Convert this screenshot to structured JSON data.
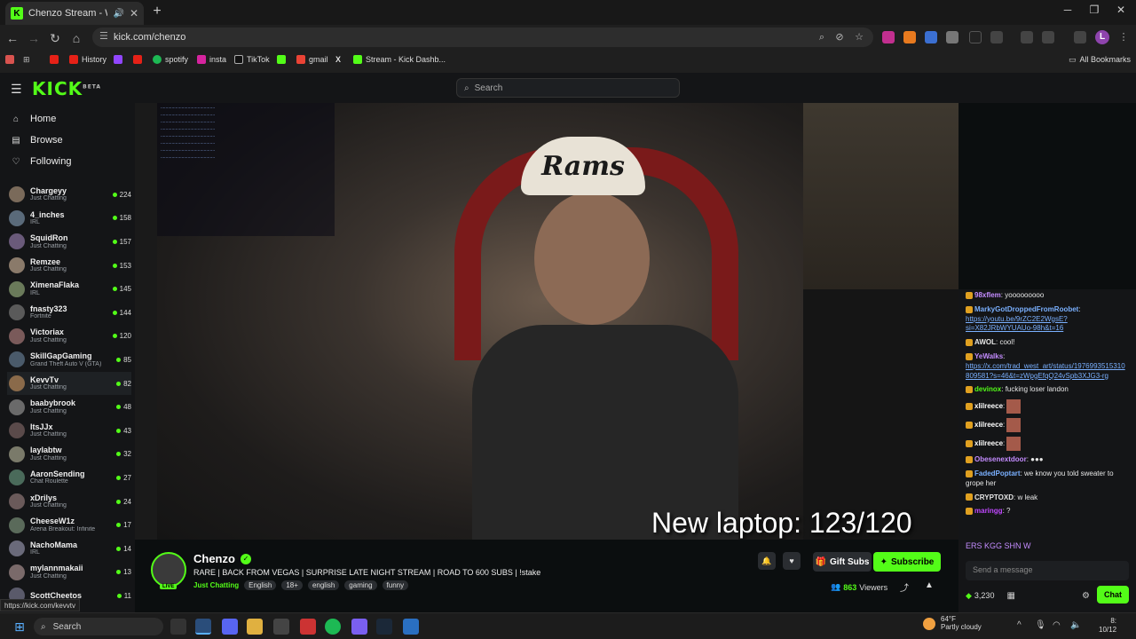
{
  "browser": {
    "tab_title": "Chenzo Stream - Watch Live",
    "url": "kick.com/chenzo",
    "bookmarks": [
      "History",
      "spotify",
      "insta",
      "TikTok",
      "gmail",
      "Stream - Kick Dashb..."
    ],
    "all_bookmarks": "All Bookmarks",
    "profile_initial": "L",
    "status_url": "https://kick.com/kevvtv"
  },
  "header": {
    "logo": "KICK",
    "logo_badge": "BETA",
    "search_placeholder": "Search"
  },
  "sidebar": {
    "nav": [
      {
        "label": "Home",
        "icon": "home-icon"
      },
      {
        "label": "Browse",
        "icon": "browse-icon"
      },
      {
        "label": "Following",
        "icon": "heart-icon"
      }
    ],
    "followed": [
      {
        "name": "Chargeyy",
        "category": "Just Chatting",
        "viewers": "224"
      },
      {
        "name": "4_inches",
        "category": "IRL",
        "viewers": "158"
      },
      {
        "name": "SquidRon",
        "category": "Just Chatting",
        "viewers": "157"
      },
      {
        "name": "Remzee",
        "category": "Just Chatting",
        "viewers": "153"
      },
      {
        "name": "XimenaFlaka",
        "category": "IRL",
        "viewers": "145"
      },
      {
        "name": "fnasty323",
        "category": "Fortnite",
        "viewers": "144"
      },
      {
        "name": "Victoriax",
        "category": "Just Chatting",
        "viewers": "120"
      },
      {
        "name": "SkillGapGaming",
        "category": "Grand Theft Auto V (GTA)",
        "viewers": "85"
      },
      {
        "name": "KevvTv",
        "category": "Just Chatting",
        "viewers": "82"
      },
      {
        "name": "baabybrook",
        "category": "Just Chatting",
        "viewers": "48"
      },
      {
        "name": "ItsJJx",
        "category": "Just Chatting",
        "viewers": "43"
      },
      {
        "name": "laylabtw",
        "category": "Just Chatting",
        "viewers": "32"
      },
      {
        "name": "AaronSending",
        "category": "Chat Roulette",
        "viewers": "27"
      },
      {
        "name": "xDrilys",
        "category": "Just Chatting",
        "viewers": "24"
      },
      {
        "name": "CheeseW1z",
        "category": "Arena Breakout: Infinite",
        "viewers": "17"
      },
      {
        "name": "NachoMama",
        "category": "IRL",
        "viewers": "14"
      },
      {
        "name": "mylannmakaii",
        "category": "Just Chatting",
        "viewers": "13"
      },
      {
        "name": "ScottCheetos",
        "category": "",
        "viewers": "11"
      }
    ]
  },
  "video": {
    "overlay_text": "New laptop: 123/120",
    "cap_text": "Rams"
  },
  "stream": {
    "streamer": "Chenzo",
    "live_label": "LIVE",
    "title": "RARE | BACK FROM VEGAS | SURPRISE LATE NIGHT STREAM | ROAD TO 600 SUBS | !stake",
    "category": "Just Chatting",
    "tags": [
      "English",
      "18+",
      "english",
      "gaming",
      "funny"
    ],
    "gift_label": "Gift Subs",
    "subscribe_label": "Subscribe",
    "viewers_count": "863",
    "viewers_label": "Viewers"
  },
  "chat": {
    "messages": [
      {
        "user": "98xflem",
        "text": "yooooooooo",
        "color": "#c48cff"
      },
      {
        "user": "MarkyGotDroppedFromRoobet",
        "text": "https://youtu.be/9rZC2E2WgsE?si=X82JRbWYUAUo-98h&t=16",
        "color": "#7ab0ff",
        "link": true
      },
      {
        "user": "AWOL",
        "text": "cool!",
        "color": "#e6e6e6"
      },
      {
        "user": "YeWalks",
        "text": "https://x.com/trad_west_art/status/1976993515310809581?s=46&t=zWpgEfqQ24vSpb3XJG3-rg",
        "color": "#c48cff",
        "link": true
      },
      {
        "user": "devinox",
        "text": "fucking loser landon",
        "color": "#53fc18"
      },
      {
        "user": "xlilreece",
        "text": "",
        "color": "#ffffff",
        "emote": true
      },
      {
        "user": "xlilreece",
        "text": "",
        "color": "#ffffff",
        "emote": true
      },
      {
        "user": "xlilreece",
        "text": "",
        "color": "#ffffff",
        "emote": true
      },
      {
        "user": "Obesenextdoor",
        "text": "●●●",
        "color": "#c48cff"
      },
      {
        "user": "FadedPoptart",
        "text": "we know you told sweater to grope her",
        "color": "#7ab0ff"
      },
      {
        "user": "CRYPTOXD",
        "text": "w leak",
        "color": "#e6e6e6"
      },
      {
        "user": "maringg",
        "text": "?",
        "color": "#c048ff"
      }
    ],
    "emote_strip": "ERS KGG SHN W",
    "input_placeholder": "Send a message",
    "points": "3,230",
    "chat_button": "Chat"
  },
  "taskbar": {
    "search": "Search",
    "weather_temp": "64°F",
    "weather_desc": "Partly cloudy",
    "time": "8:",
    "date": "10/12"
  }
}
